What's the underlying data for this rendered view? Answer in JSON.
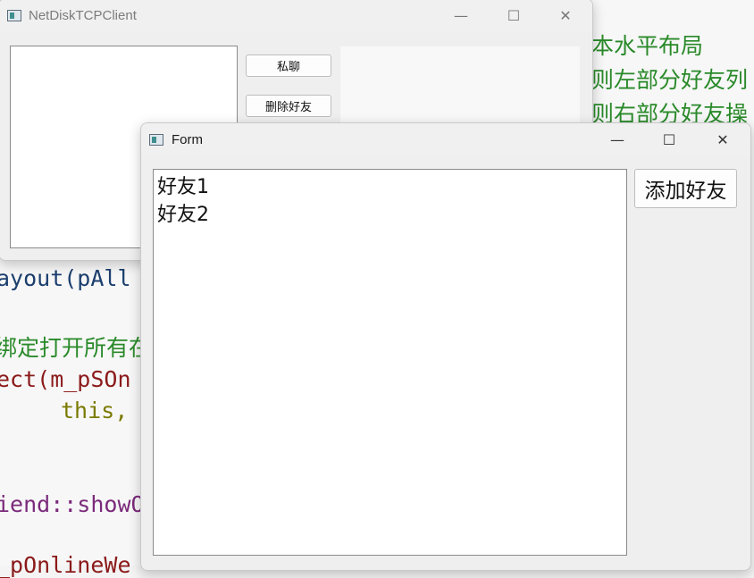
{
  "editor": {
    "code_lines": [
      "ayout(pAll",
      "绑定打开所有在",
      "ect(m_pSOn",
      "this,",
      "iend::showO",
      "_pOnlineWe"
    ],
    "comments": [
      "本水平布局",
      "则左部分好友列",
      "则右部分好友操"
    ]
  },
  "main_window": {
    "title": "NetDiskTCPClient",
    "btn_private_chat": "私聊",
    "btn_delete_friend": "删除好友"
  },
  "form_window": {
    "title": "Form",
    "friends": [
      "好友1",
      "好友2"
    ],
    "btn_add_friend": "添加好友"
  },
  "window_controls": {
    "minimize": "—",
    "maximize": "☐",
    "close": "✕"
  },
  "colors": {
    "comment": "#2a8a2a",
    "identifier": "#1c3f6e",
    "member": "#8b1a1a",
    "keyword": "#7a7a00",
    "class_name": "#7b2a7b",
    "function_name": "#1a6e80"
  }
}
